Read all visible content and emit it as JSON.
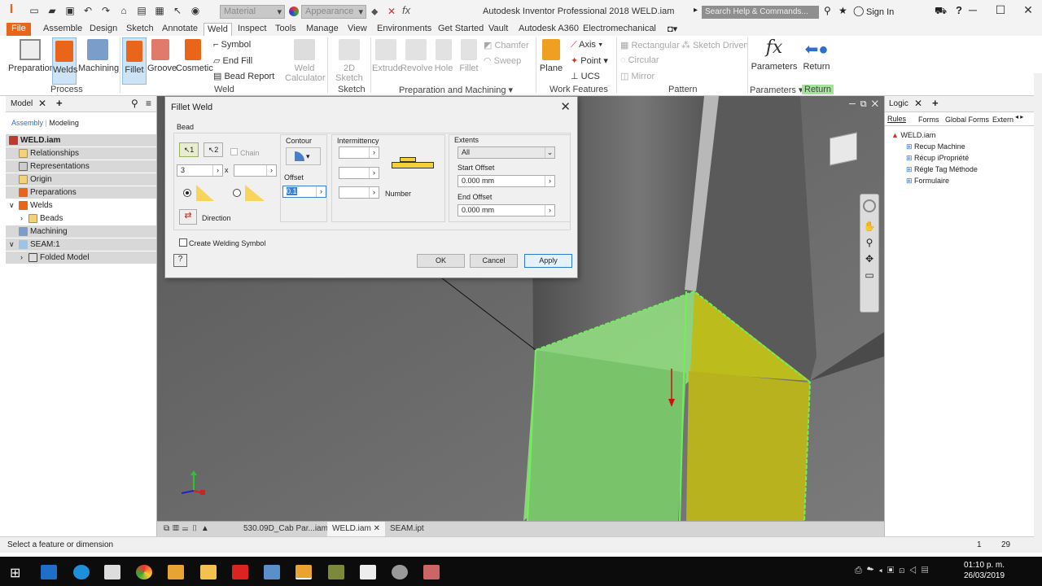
{
  "window": {
    "title": "Autodesk Inventor Professional 2018   WELD.iam",
    "search_placeholder": "Search Help & Commands...",
    "signin": "Sign In"
  },
  "qat": {
    "material": "Material",
    "appearance": "Appearance"
  },
  "tabs": [
    "File",
    "Assemble",
    "Design",
    "Sketch",
    "Annotate",
    "Weld",
    "Inspect",
    "Tools",
    "Manage",
    "View",
    "Environments",
    "Get Started",
    "Vault",
    "Autodesk A360",
    "Electromechanical"
  ],
  "ribbon": {
    "process": {
      "label": "Process",
      "buttons": [
        "Preparation",
        "Welds",
        "Machining"
      ]
    },
    "weld": {
      "label": "Weld",
      "buttons": [
        "Fillet",
        "Groove",
        "Cosmetic"
      ],
      "small": [
        "Symbol",
        "End Fill",
        "Bead Report"
      ],
      "calc": "Weld Calculator"
    },
    "sketch": {
      "label": "Sketch",
      "button": "2D Sketch"
    },
    "prep": {
      "label": "Preparation and Machining",
      "buttons": [
        "Extrude",
        "Revolve",
        "Hole",
        "Fillet"
      ],
      "small": [
        "Chamfer",
        "Sweep"
      ]
    },
    "work": {
      "label": "Work Features",
      "plane": "Plane",
      "small": [
        "Axis",
        "Point",
        "UCS"
      ]
    },
    "pattern": {
      "label": "Pattern",
      "small": [
        "Rectangular",
        "Circular",
        "Mirror",
        "Sketch Driven"
      ]
    },
    "params": {
      "label": "Parameters",
      "button": "Parameters"
    },
    "ret": {
      "label": "Return",
      "button": "Return"
    }
  },
  "browser": {
    "tabs": [
      "Model"
    ],
    "subtabs": [
      "Assembly",
      "Modeling"
    ],
    "items": [
      "WELD.iam",
      "Relationships",
      "Representations",
      "Origin",
      "Preparations",
      "Welds",
      "Beads",
      "Machining",
      "SEAM:1",
      "Folded Model"
    ]
  },
  "dialog": {
    "title": "Fillet Weld",
    "bead": "Bead",
    "chain": "Chain",
    "size1": "3",
    "times": "x",
    "contour": "Contour",
    "offset": "Offset",
    "offset_value": "0.1",
    "intermittency": "Intermittency",
    "number": "Number",
    "direction": "Direction",
    "extents": "Extents",
    "extents_value": "All",
    "start_offset": "Start Offset",
    "start_value": "0.000 mm",
    "end_offset": "End Offset",
    "end_value": "0.000 mm",
    "create_symbol": "Create Welding Symbol",
    "ok": "OK",
    "cancel": "Cancel",
    "apply": "Apply",
    "sel1": "1",
    "sel2": "2"
  },
  "logic": {
    "tab": "Logic",
    "subtabs": [
      "Rules",
      "Forms",
      "Global Forms",
      "Extern"
    ],
    "root": "WELD.iam",
    "rules": [
      "Recup Machine",
      "Récup iPropriété",
      "Régle Tag Méthode",
      "Formulaire"
    ]
  },
  "doc_tabs": [
    "530.09D_Cab Par...iam",
    "WELD.iam",
    "SEAM.ipt"
  ],
  "status": {
    "message": "Select a feature or dimension",
    "n1": "1",
    "n2": "29"
  },
  "clock": {
    "time": "01:10 p. m.",
    "date": "26/03/2019"
  },
  "colors": {
    "accent": "#e8651a",
    "weld_green": "#7bd36b",
    "weld_yellow": "#c6c321",
    "viewport": "#6c6c6c"
  }
}
